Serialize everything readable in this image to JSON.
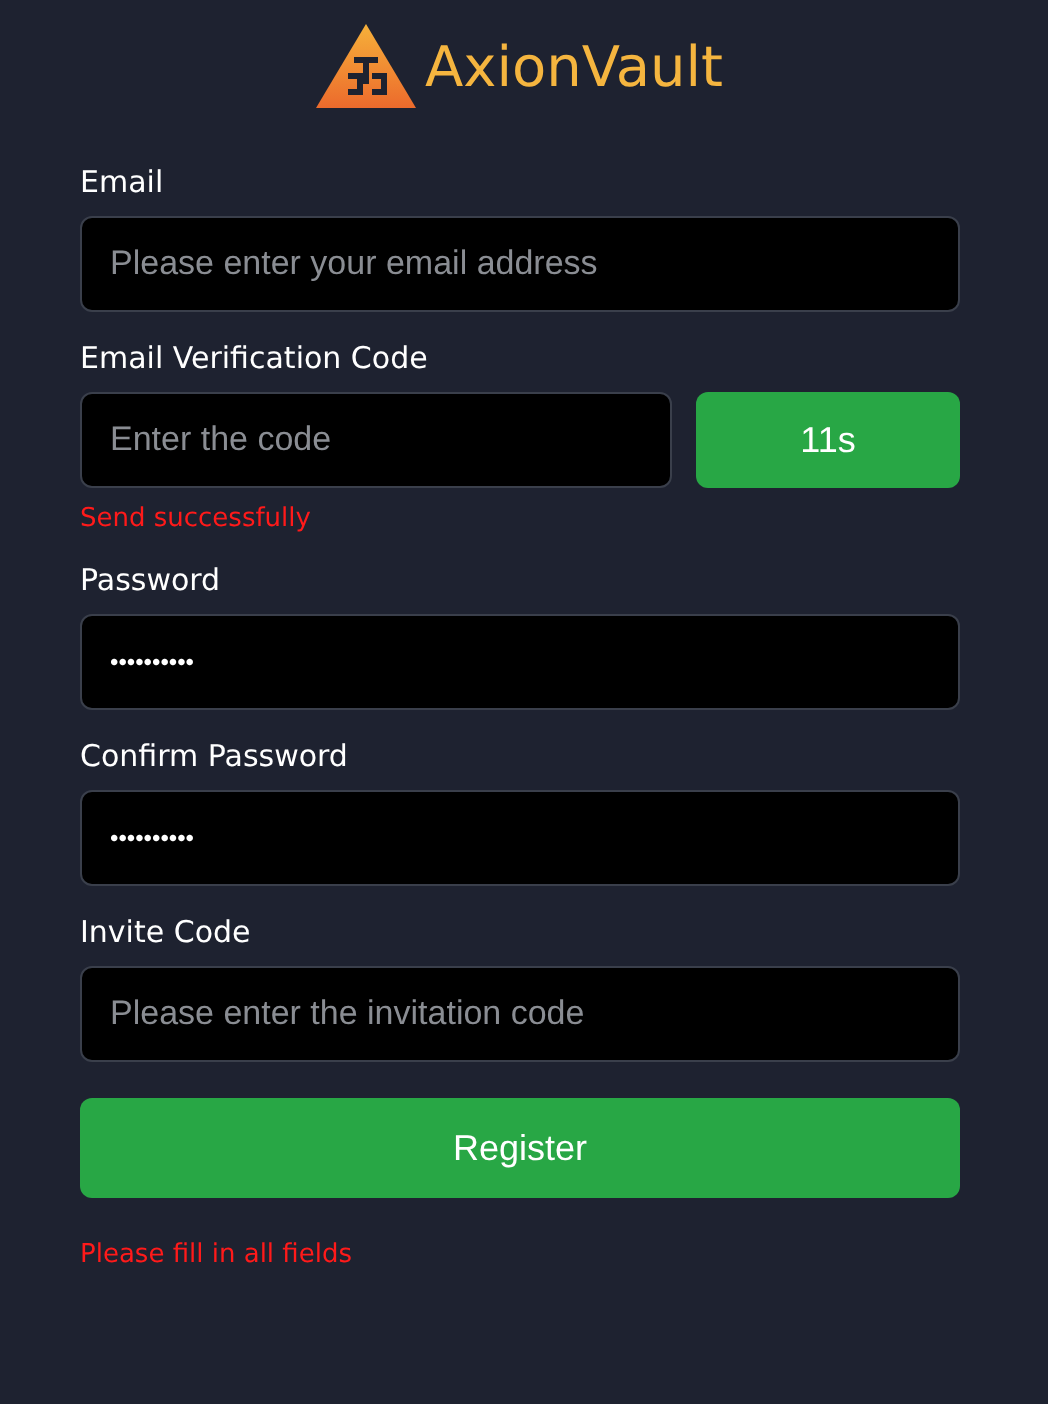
{
  "logo": {
    "text": "AxionVault"
  },
  "fields": [
    {
      "kind": "text",
      "label": "Email",
      "placeholder": "Please enter your email address"
    },
    {
      "kind": "code",
      "label": "Email Verification Code",
      "placeholder": "Enter the code",
      "button": "11s",
      "message": "Send successfully"
    },
    {
      "kind": "password",
      "label": "Password",
      "value": "••••••••••"
    },
    {
      "kind": "password",
      "label": "Confirm Password",
      "value": "••••••••••"
    },
    {
      "kind": "text",
      "label": "Invite Code",
      "placeholder": "Please enter the invitation code"
    }
  ],
  "submit": "Register",
  "error": "Please fill in all fields"
}
